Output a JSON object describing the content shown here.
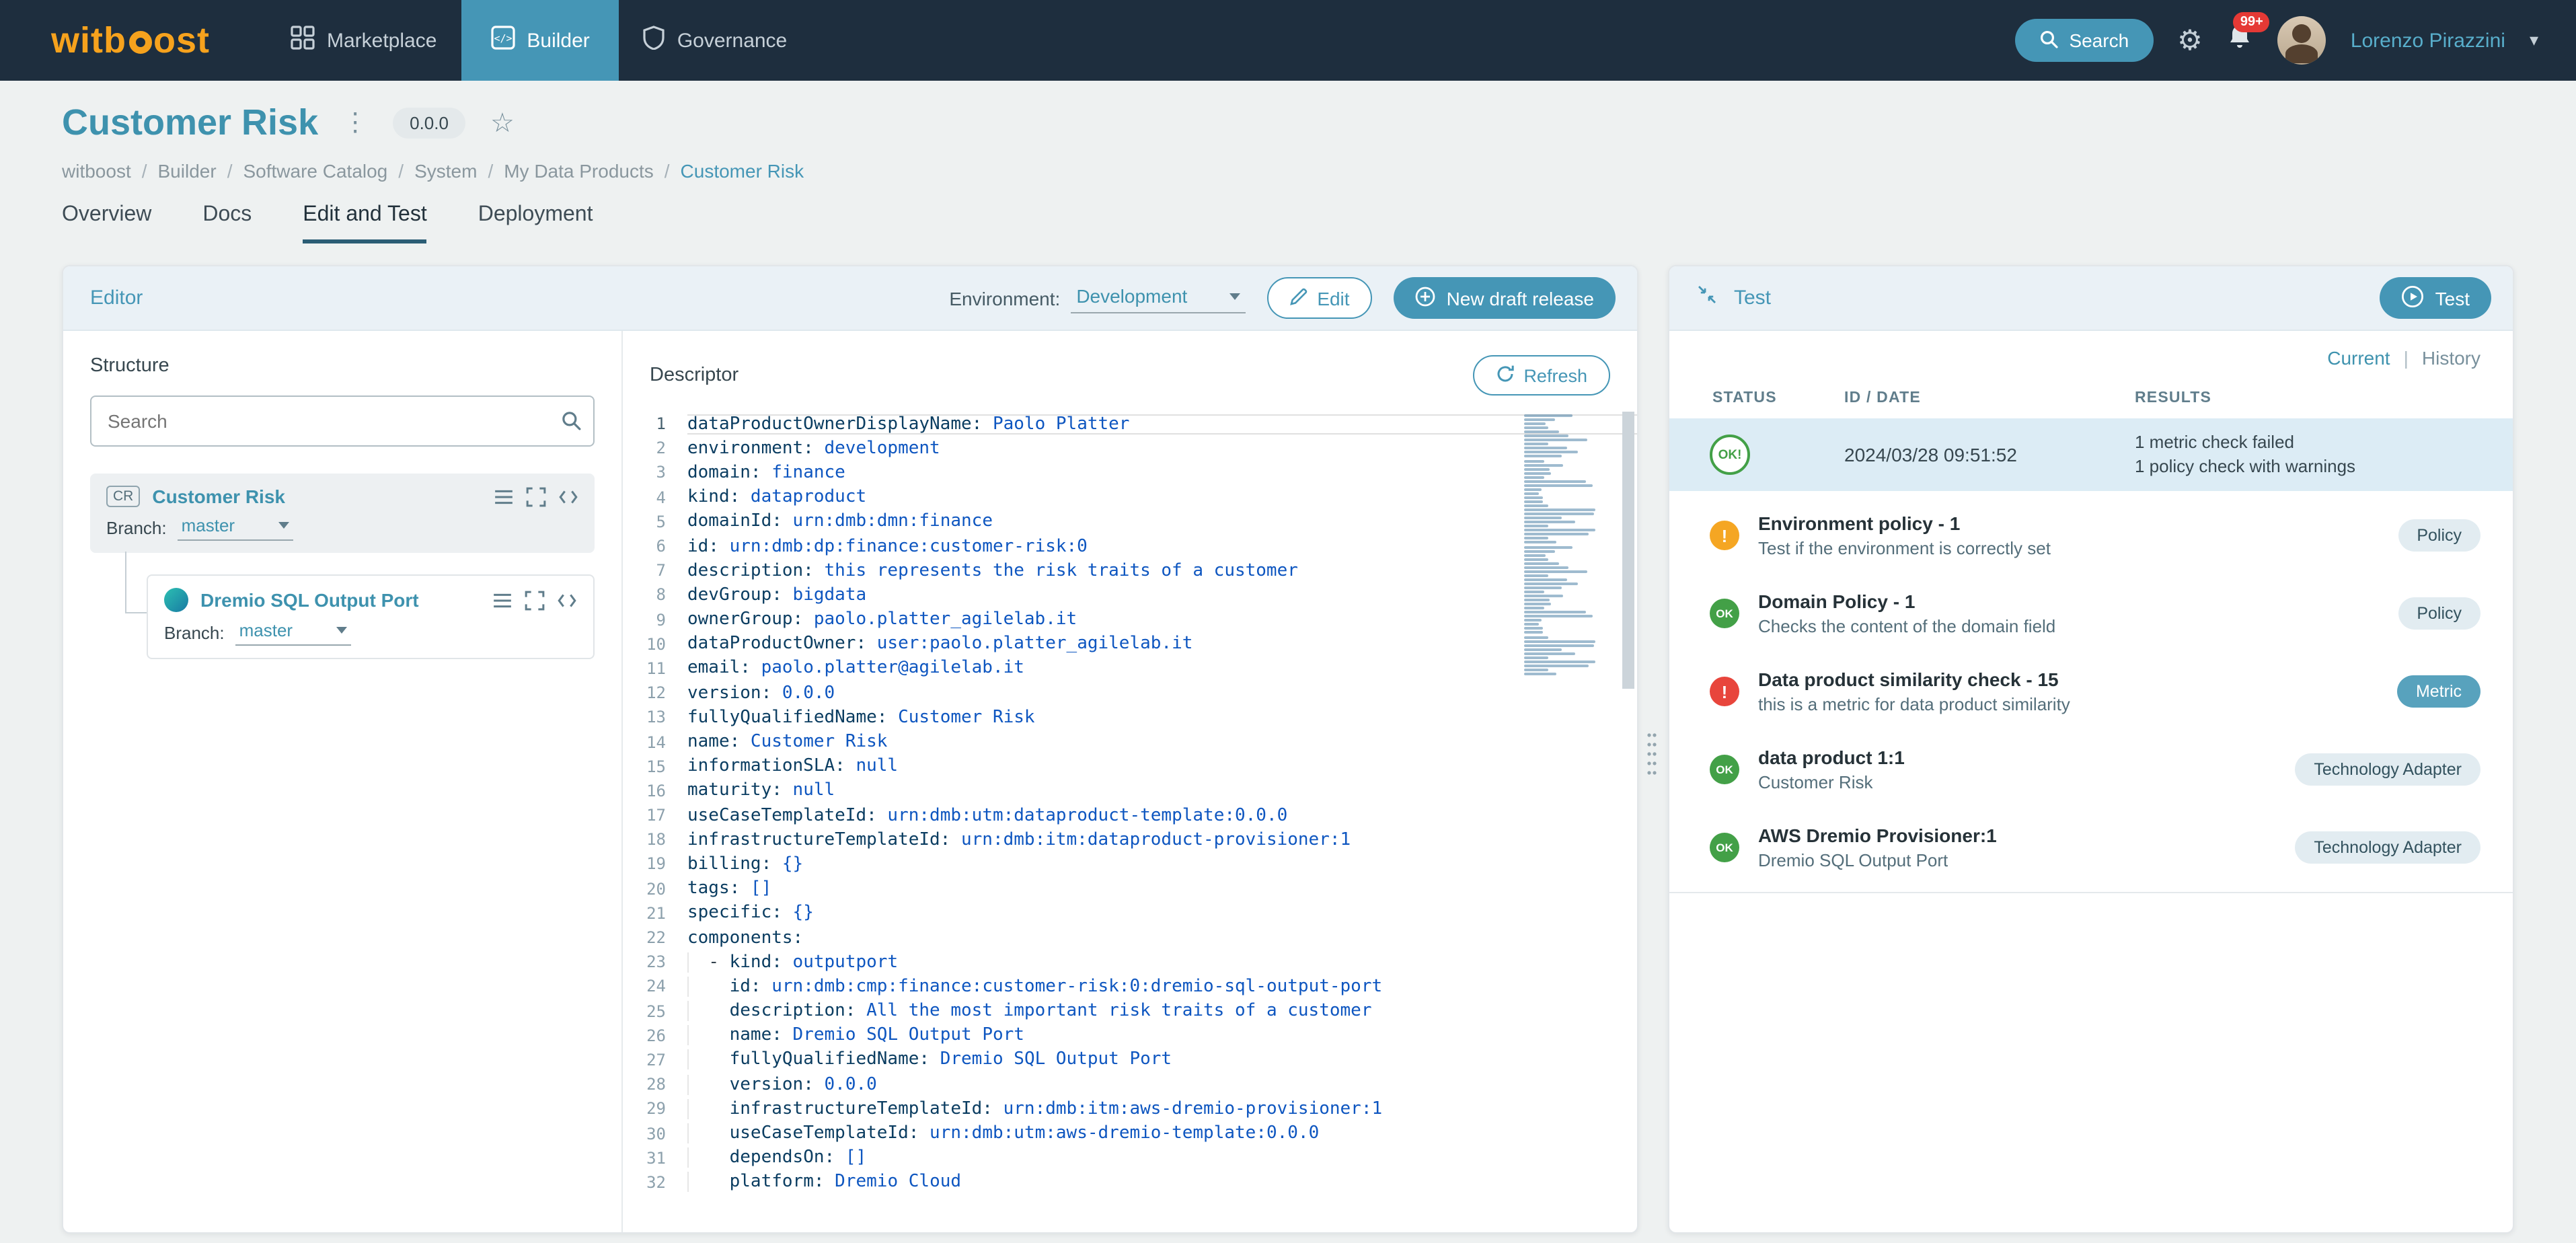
{
  "colors": {
    "navbar": "#1e2e3e",
    "accent": "#4596b6",
    "accent-text": "#3e92ae",
    "logo": "#f6a21d",
    "page-bg": "#eef1f1",
    "strip": "#eaf1f6",
    "selected-row": "#dcecf5",
    "ok": "#43a047",
    "warn": "#f5a623",
    "error": "#e8453c",
    "badge": "#e53935",
    "code-key": "#0b3d61",
    "code-val": "#0e56c0"
  },
  "navbar": {
    "logo": {
      "text": "witboost",
      "left": "witb",
      "right": "ost"
    },
    "items": [
      {
        "label": "Marketplace",
        "active": false
      },
      {
        "label": "Builder",
        "active": true
      },
      {
        "label": "Governance",
        "active": false
      }
    ],
    "search_label": "Search",
    "notifications_badge": "99+",
    "user_name": "Lorenzo Pirazzini"
  },
  "header": {
    "title": "Customer Risk",
    "version": "0.0.0",
    "breadcrumb": [
      "witboost",
      "Builder",
      "Software Catalog",
      "System",
      "My Data Products",
      "Customer Risk"
    ],
    "tabs": [
      "Overview",
      "Docs",
      "Edit and Test",
      "Deployment"
    ],
    "active_tab": "Edit and Test"
  },
  "editor": {
    "title": "Editor",
    "environment_label": "Environment:",
    "environment_value": "Development",
    "edit_button": "Edit",
    "new_draft_button": "New draft release",
    "structure": {
      "title": "Structure",
      "search_placeholder": "Search",
      "nodes": [
        {
          "badge": "CR",
          "name": "Customer Risk",
          "branch_label": "Branch:",
          "branch": "master"
        },
        {
          "icon": "dremio-icon",
          "name": "Dremio SQL Output Port",
          "branch_label": "Branch:",
          "branch": "master"
        }
      ]
    },
    "descriptor": {
      "title": "Descriptor",
      "refresh_button": "Refresh",
      "lines": [
        {
          "ind": 0,
          "k": "dataProductOwnerDisplayName",
          "v": "Paolo Platter"
        },
        {
          "ind": 0,
          "k": "environment",
          "v": "development"
        },
        {
          "ind": 0,
          "k": "domain",
          "v": "finance"
        },
        {
          "ind": 0,
          "k": "kind",
          "v": "dataproduct"
        },
        {
          "ind": 0,
          "k": "domainId",
          "v": "urn:dmb:dmn:finance"
        },
        {
          "ind": 0,
          "k": "id",
          "v": "urn:dmb:dp:finance:customer-risk:0"
        },
        {
          "ind": 0,
          "k": "description",
          "v": "this represents the risk traits of a customer"
        },
        {
          "ind": 0,
          "k": "devGroup",
          "v": "bigdata"
        },
        {
          "ind": 0,
          "k": "ownerGroup",
          "v": "paolo.platter_agilelab.it"
        },
        {
          "ind": 0,
          "k": "dataProductOwner",
          "v": "user:paolo.platter_agilelab.it"
        },
        {
          "ind": 0,
          "k": "email",
          "v": "paolo.platter@agilelab.it"
        },
        {
          "ind": 0,
          "k": "version",
          "v": "0.0.0"
        },
        {
          "ind": 0,
          "k": "fullyQualifiedName",
          "v": "Customer Risk"
        },
        {
          "ind": 0,
          "k": "name",
          "v": "Customer Risk"
        },
        {
          "ind": 0,
          "k": "informationSLA",
          "v": "null"
        },
        {
          "ind": 0,
          "k": "maturity",
          "v": "null"
        },
        {
          "ind": 0,
          "k": "useCaseTemplateId",
          "v": "urn:dmb:utm:dataproduct-template:0.0.0"
        },
        {
          "ind": 0,
          "k": "infrastructureTemplateId",
          "v": "urn:dmb:itm:dataproduct-provisioner:1"
        },
        {
          "ind": 0,
          "k": "billing",
          "v": "{}"
        },
        {
          "ind": 0,
          "k": "tags",
          "v": "[]"
        },
        {
          "ind": 0,
          "k": "specific",
          "v": "{}"
        },
        {
          "ind": 0,
          "k": "components",
          "v": ""
        },
        {
          "ind": 2,
          "d": true,
          "k": "kind",
          "v": "outputport"
        },
        {
          "ind": 4,
          "k": "id",
          "v": "urn:dmb:cmp:finance:customer-risk:0:dremio-sql-output-port"
        },
        {
          "ind": 4,
          "k": "description",
          "v": "All the most important risk traits of a customer"
        },
        {
          "ind": 4,
          "k": "name",
          "v": "Dremio SQL Output Port"
        },
        {
          "ind": 4,
          "k": "fullyQualifiedName",
          "v": "Dremio SQL Output Port"
        },
        {
          "ind": 4,
          "k": "version",
          "v": "0.0.0"
        },
        {
          "ind": 4,
          "k": "infrastructureTemplateId",
          "v": "urn:dmb:itm:aws-dremio-provisioner:1"
        },
        {
          "ind": 4,
          "k": "useCaseTemplateId",
          "v": "urn:dmb:utm:aws-dremio-template:0.0.0"
        },
        {
          "ind": 4,
          "k": "dependsOn",
          "v": "[]"
        },
        {
          "ind": 4,
          "k": "platform",
          "v": "Dremio Cloud"
        }
      ]
    }
  },
  "test": {
    "title": "Test",
    "run_button": "Test",
    "tabs": [
      "Current",
      "History"
    ],
    "columns": [
      "STATUS",
      "ID / DATE",
      "RESULTS"
    ],
    "run": {
      "status": "OK!",
      "date": "2024/03/28 09:51:52",
      "results": [
        "1 metric check failed",
        "1 policy check with warnings"
      ]
    },
    "checks": [
      {
        "status": "warn",
        "icon_text": "!",
        "title": "Environment policy - 1",
        "subtitle": "Test if the environment is correctly set",
        "tag": "Policy",
        "tag_style": "light"
      },
      {
        "status": "ok",
        "icon_text": "OK",
        "title": "Domain Policy - 1",
        "subtitle": "Checks the content of the domain field",
        "tag": "Policy",
        "tag_style": "light"
      },
      {
        "status": "error",
        "icon_text": "!",
        "title": "Data product similarity check - 15",
        "subtitle": "this is a metric for data product similarity",
        "tag": "Metric",
        "tag_style": "filled"
      },
      {
        "status": "ok",
        "icon_text": "OK",
        "title": "data product 1:1",
        "subtitle": "Customer Risk",
        "tag": "Technology Adapter",
        "tag_style": "light"
      },
      {
        "status": "ok",
        "icon_text": "OK",
        "title": "AWS Dremio Provisioner:1",
        "subtitle": "Dremio SQL Output Port",
        "tag": "Technology Adapter",
        "tag_style": "light"
      }
    ]
  }
}
